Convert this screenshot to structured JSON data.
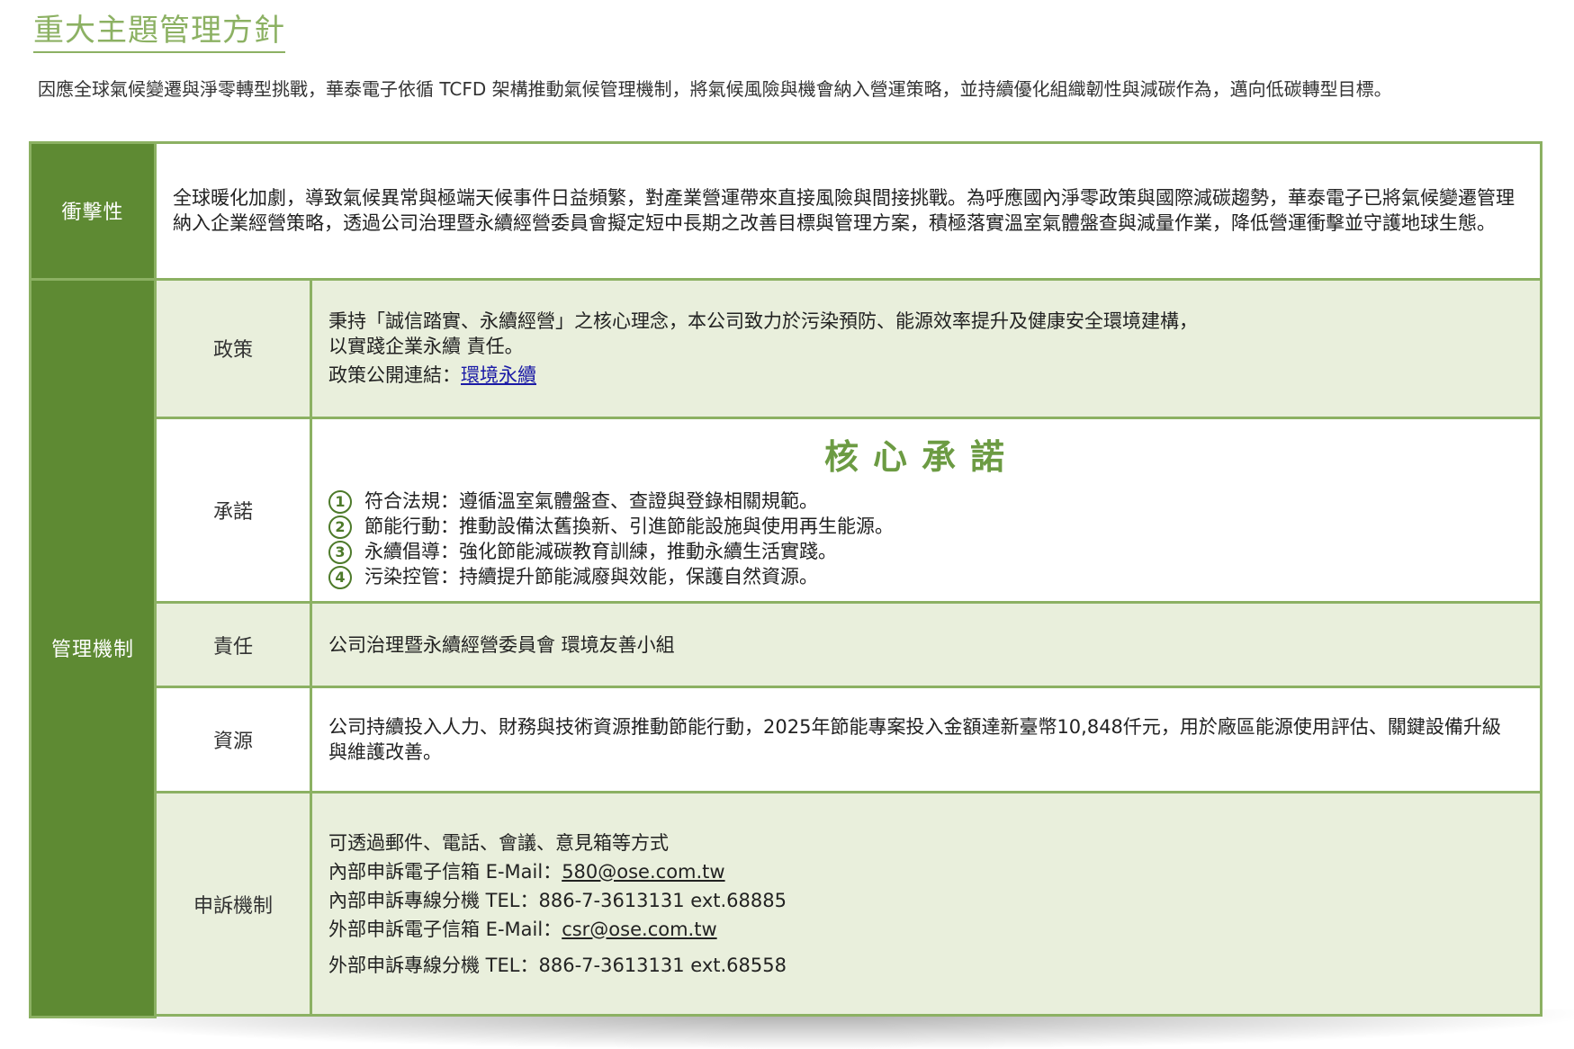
{
  "header": {
    "title": "重大主題管理方針",
    "intro": "因應全球氣候變遷與淨零轉型挑戰，華泰電子依循 TCFD 架構推動氣候管理機制，將氣候風險與機會納入營運策略，並持續優化組織韌性與減碳作為，邁向低碳轉型目標。"
  },
  "impact": {
    "label": "衝擊性",
    "text": "全球暖化加劇，導致氣候異常與極端天候事件日益頻繁，對產業營運帶來直接風險與間接挑戰。為呼應國內淨零政策與國際減碳趨勢，華泰電子已將氣候變遷管理納入企業經營策略，透過公司治理暨永續經營委員會擬定短中長期之改善目標與管理方案，積極落實溫室氣體盤查與減量作業，降低營運衝擊並守護地球生態。"
  },
  "management": {
    "label": "管理機制",
    "policy": {
      "label": "政策",
      "line1": "秉持「誠信踏實、永續經營」之核心理念，本公司致力於污染預防、能源效率提升及健康安全環境建構，",
      "line2": "以實踐企業永續 責任。",
      "link_prefix": "政策公開連結：",
      "link_text": "環境永續"
    },
    "commitment": {
      "label": "承諾",
      "title": "核心承諾",
      "items": [
        {
          "num": "1",
          "text": "符合法規：遵循溫室氣體盤查、查證與登錄相關規範。"
        },
        {
          "num": "2",
          "text": "節能行動：推動設備汰舊換新、引進節能設施與使用再生能源。"
        },
        {
          "num": "3",
          "text": "永續倡導：強化節能減碳教育訓練，推動永續生活實踐。"
        },
        {
          "num": "4",
          "text": "污染控管：持續提升節能減廢與效能，保護自然資源。"
        }
      ]
    },
    "responsibility": {
      "label": "責任",
      "text": "公司治理暨永續經營委員會 環境友善小組"
    },
    "resources": {
      "label": "資源",
      "text": "公司持續投入人力、財務與技術資源推動節能行動，2025年節能專案投入金額達新臺幣10,848仟元，用於廠區能源使用評估、關鍵設備升級與維護改善。"
    },
    "grievance": {
      "label": "申訴機制",
      "intro": "可透過郵件、電話、會議、意見箱等方式",
      "internal_email_label": "內部申訴電子信箱 E-Mail：",
      "internal_email": "580@ose.com.tw",
      "internal_tel_label": "內部申訴專線分機 TEL：",
      "internal_tel": "886-7-3613131 ext.68885",
      "external_email_label": "外部申訴電子信箱 E-Mail：",
      "external_email": "csr@ose.com.tw",
      "external_tel_label": "外部申訴專線分機 TEL：",
      "external_tel": "886-7-3613131 ext.68558"
    }
  },
  "colors": {
    "accent_green": "#8cb163",
    "dark_green": "#5e8a33",
    "tint": "#e9efdc"
  }
}
